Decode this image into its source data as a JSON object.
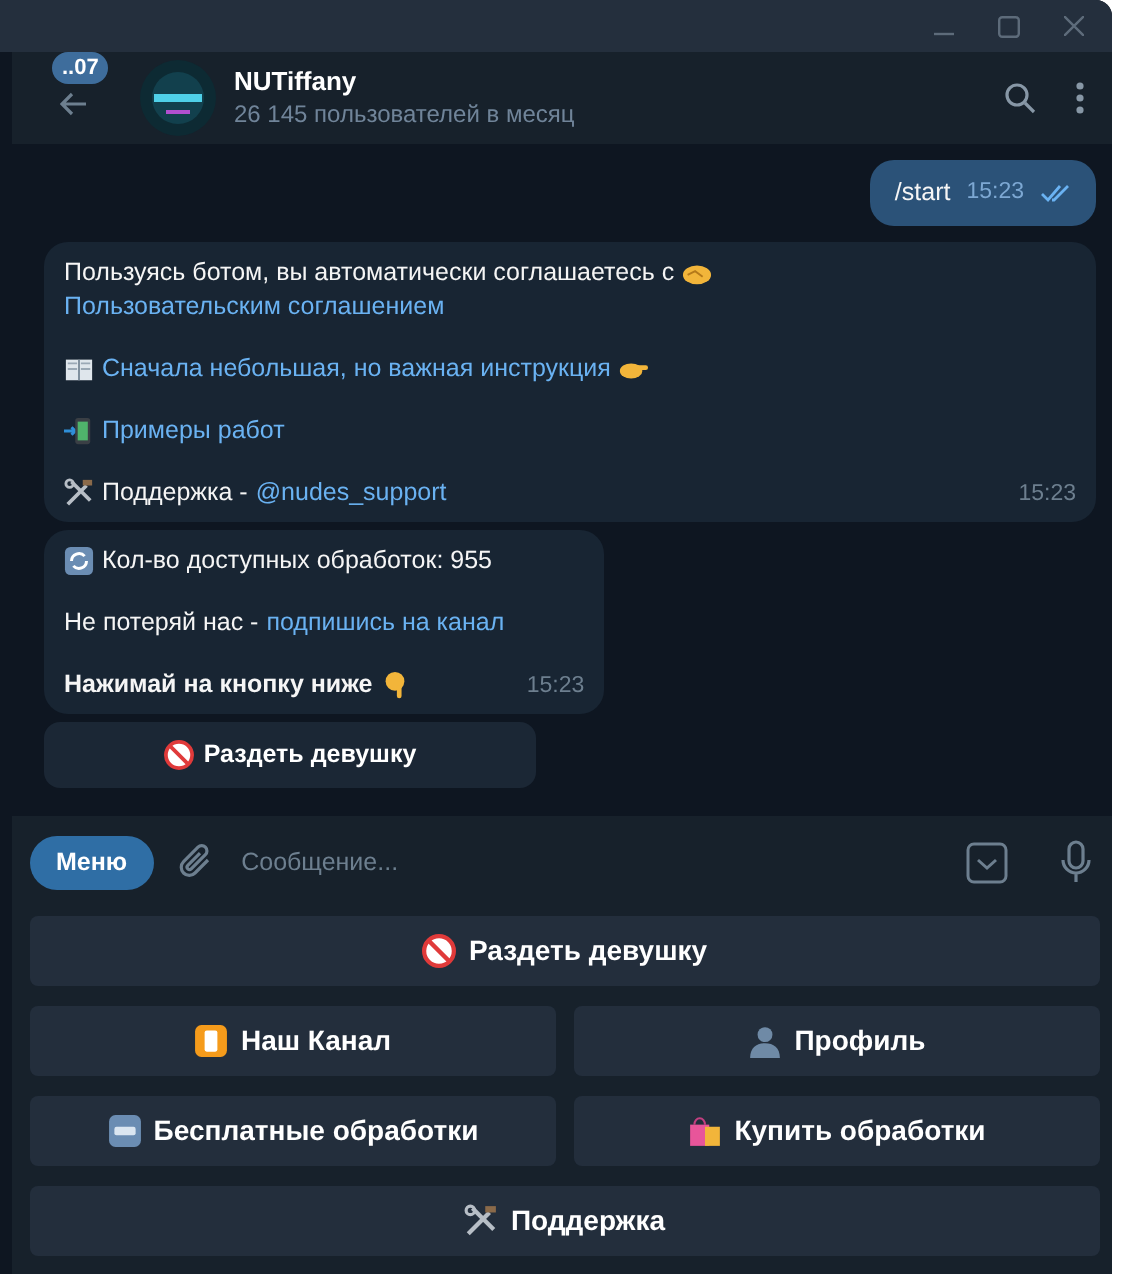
{
  "header": {
    "back_badge": "..07",
    "title": "NUTiffany",
    "subtitle": "26 145 пользователей в месяц"
  },
  "messages": [
    {
      "kind": "outgoing",
      "time": "15:23",
      "read": true,
      "paragraphs": [
        {
          "bold": false,
          "parts": [
            {
              "text": "/start",
              "link": false
            }
          ]
        }
      ]
    },
    {
      "kind": "incoming",
      "time": "15:23",
      "paragraphs": [
        {
          "bold": false,
          "parts": [
            {
              "text": "Пользуясь ботом, вы автоматически соглашаетесь с",
              "link": false
            },
            {
              "text": "Пользовательским соглашением",
              "link": true
            }
          ]
        },
        {
          "bold": false,
          "parts": [
            {
              "text": "Сначала небольшая, но важная инструкция",
              "link": true
            }
          ]
        },
        {
          "bold": false,
          "parts": [
            {
              "text": "Примеры работ",
              "link": true
            }
          ]
        },
        {
          "bold": false,
          "parts": [
            {
              "text": "Поддержка -",
              "link": false
            },
            {
              "text": "@nudes_support",
              "link": true
            }
          ]
        }
      ]
    },
    {
      "kind": "incoming",
      "time": "15:23",
      "paragraphs": [
        {
          "bold": false,
          "parts": [
            {
              "text": "Кол-во доступных обработок: 955",
              "link": false
            }
          ]
        },
        {
          "bold": false,
          "parts": [
            {
              "text": "Не потеряй нас -",
              "link": false
            },
            {
              "text": "подпишись на канал",
              "link": true
            }
          ]
        },
        {
          "bold": true,
          "parts": [
            {
              "text": "Нажимай на кнопку ниже",
              "link": false
            }
          ]
        }
      ],
      "inline_buttons": [
        "Раздеть девушку"
      ]
    }
  ],
  "composer": {
    "menu_button": "Меню",
    "placeholder": "Сообщение..."
  },
  "keyboard": [
    [
      "Раздеть девушку"
    ],
    [
      "Наш Канал",
      "Профиль"
    ],
    [
      "Бесплатные обработки",
      "Купить обработки"
    ],
    [
      "Поддержка"
    ]
  ]
}
